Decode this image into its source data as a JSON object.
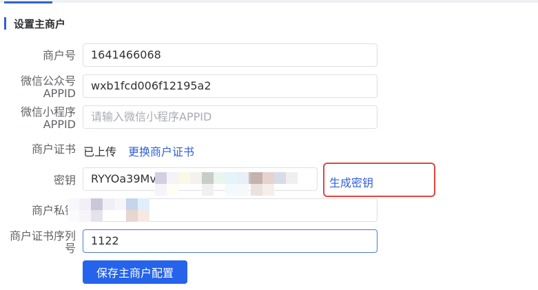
{
  "section": {
    "title": "设置主商户"
  },
  "form": {
    "merchant_no": {
      "label": "商户号",
      "value": "1641466068"
    },
    "wechat_oa_appid": {
      "label_line1": "微信公众号",
      "label_line2": "APPID",
      "value": "wxb1fcd006f12195a2"
    },
    "wechat_mini_appid": {
      "label_line1": "微信小程序",
      "label_line2": "APPID",
      "placeholder": "请输入微信小程序APPID"
    },
    "merchant_cert": {
      "label": "商户证书",
      "status": "已上传",
      "change_link": "更换商户证书"
    },
    "secret_key": {
      "label": "密钥",
      "value_visible": "RYYOa39Mv",
      "generate_link": "生成密钥"
    },
    "private_key": {
      "label_visible": "商户私钥"
    },
    "cert_serial": {
      "label_line1": "商户证书序列",
      "label_line2": "号",
      "value": "1122"
    }
  },
  "actions": {
    "save_label": "保存主商户配置"
  },
  "colors": {
    "accent": "#2f5fd8",
    "highlight": "#e2453c",
    "button": "#2563eb"
  }
}
